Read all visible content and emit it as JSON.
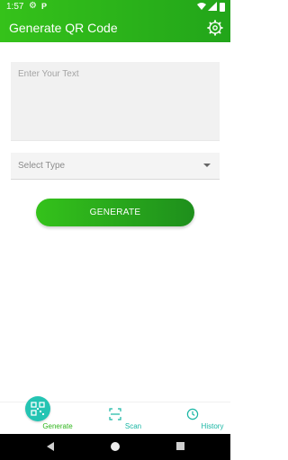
{
  "status_bar": {
    "time": "1:57",
    "icons": [
      "settings-icon",
      "parking-icon",
      "wifi-icon",
      "signal-icon",
      "battery-icon"
    ]
  },
  "app_bar": {
    "title": "Generate QR Code",
    "settings_icon": "gear-icon"
  },
  "form": {
    "text_placeholder": "Enter Your Text",
    "text_value": "",
    "type_select_label": "Select Type",
    "generate_label": "GENERATE"
  },
  "bottom_nav": {
    "items": [
      {
        "label": "Generate",
        "icon": "qr-code-icon",
        "active": true
      },
      {
        "label": "Scan",
        "icon": "scan-icon",
        "active": false
      },
      {
        "label": "History",
        "icon": "clock-icon",
        "active": false
      }
    ]
  },
  "colors": {
    "primary": "#2fb51c",
    "accent": "#24c4b3"
  }
}
